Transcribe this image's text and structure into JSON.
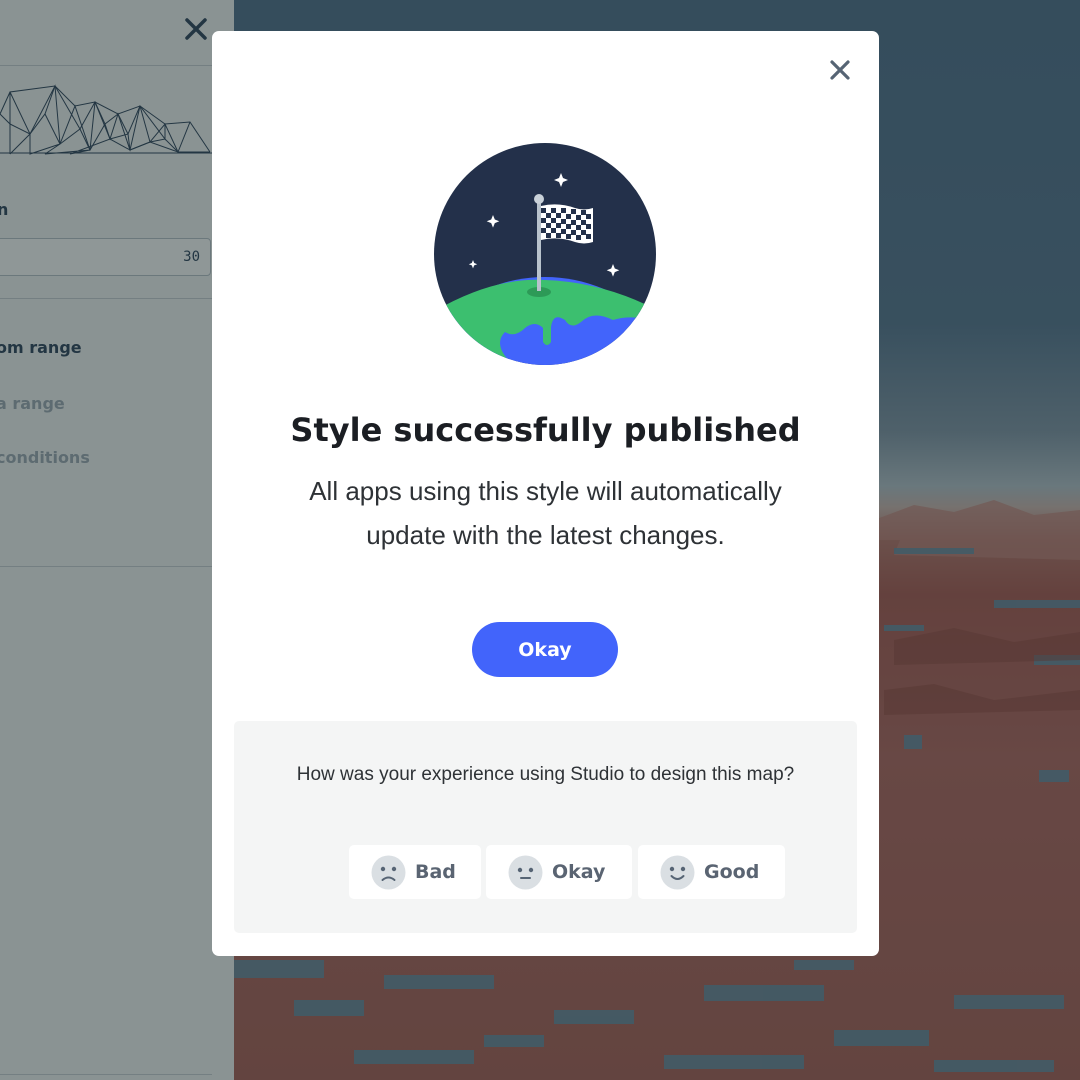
{
  "sidebar": {
    "label_partial": "n",
    "number_value": "30",
    "options": [
      {
        "label": "om range",
        "active": true
      },
      {
        "label": "a range",
        "active": false
      },
      {
        "label": "conditions",
        "active": false
      }
    ]
  },
  "modal": {
    "title": "Style successfully published",
    "description": "All apps using this style will automatically update with the latest changes.",
    "primary_button": "Okay",
    "feedback": {
      "question": "How was your experience using Studio to design this map?",
      "ratings": [
        {
          "label": "Bad",
          "icon": "sad-face-icon"
        },
        {
          "label": "Okay",
          "icon": "neutral-face-icon"
        },
        {
          "label": "Good",
          "icon": "happy-face-icon"
        }
      ]
    }
  },
  "colors": {
    "accent": "#4264fb",
    "globe_sky": "#23304a",
    "globe_land": "#3cbf6f",
    "globe_water": "#4264fb"
  }
}
